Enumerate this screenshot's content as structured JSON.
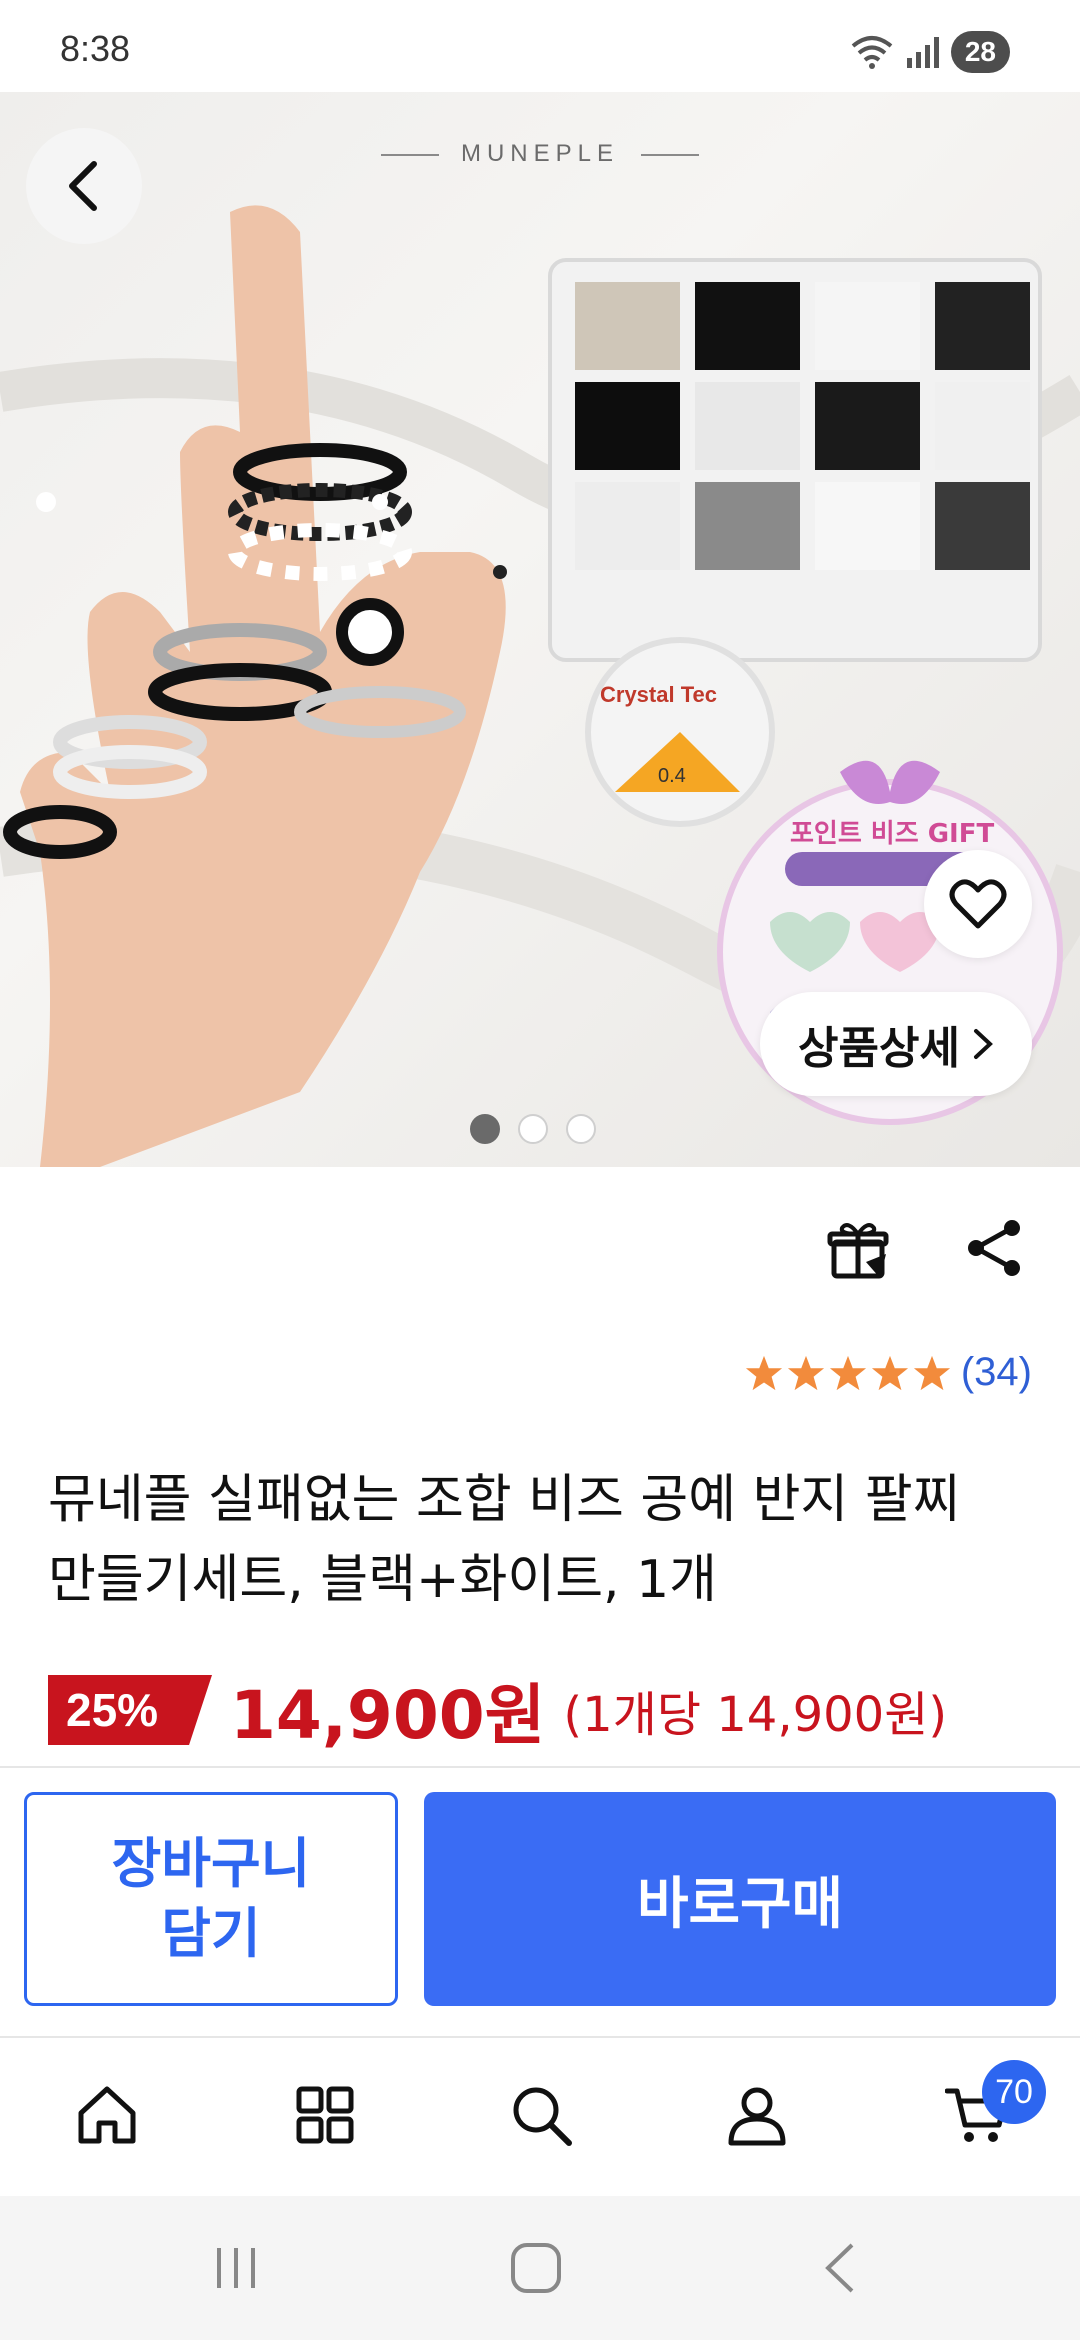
{
  "status_bar": {
    "time": "8:38",
    "battery": "28"
  },
  "hero": {
    "brand": "MUNEPLE",
    "detail_button_label": "상품상세",
    "carousel_total": 3,
    "carousel_active": 1
  },
  "rating": {
    "stars": 5,
    "review_count": "(34)"
  },
  "product": {
    "title_line1": "뮤네플 실패없는 조합 비즈 공예 반지 팔찌",
    "title_line2": "만들기세트, 블랙+화이트, 1개",
    "discount": "25%",
    "price": "14,900원",
    "unit_price": "(1개당 14,900원)"
  },
  "actions": {
    "cart_label_line1": "장바구니",
    "cart_label_line2": "담기",
    "buy_label": "바로구매"
  },
  "bottom_nav": {
    "items": [
      "home-icon",
      "category-icon",
      "search-icon",
      "user-icon",
      "cart-icon"
    ],
    "cart_badge": "70"
  },
  "colors": {
    "accent": "#3a6cf4",
    "price_red": "#c8141e",
    "star": "#f28b3c",
    "link_blue": "#2f5fd5"
  }
}
